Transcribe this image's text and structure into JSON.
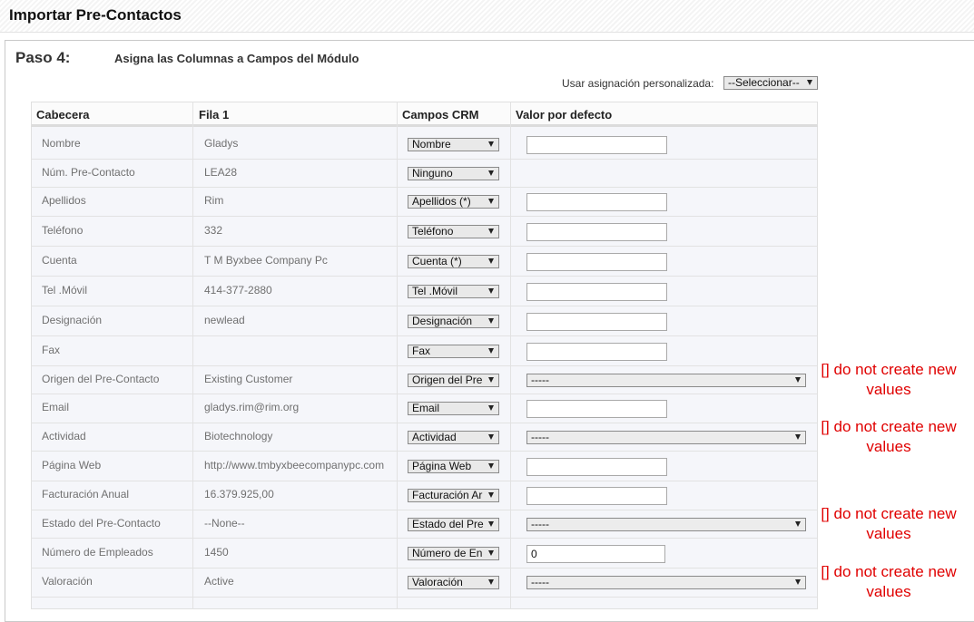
{
  "page": {
    "title": "Importar Pre-Contactos"
  },
  "step": {
    "label": "Paso 4:",
    "description": "Asigna las Columnas a Campos del Módulo"
  },
  "custom_mapping": {
    "label": "Usar asignación personalizada:",
    "value": "--Seleccionar--"
  },
  "table": {
    "headers": [
      "Cabecera",
      "Fila 1",
      "Campos CRM",
      "Valor por defecto"
    ],
    "rows": [
      {
        "header": "Nombre",
        "row1": "Gladys",
        "crm": "Nombre",
        "default": ""
      },
      {
        "header": "Núm. Pre-Contacto",
        "row1": "LEA28",
        "crm": "Ninguno"
      },
      {
        "header": "Apellidos",
        "row1": "Rim",
        "crm": "Apellidos  (*)",
        "default": ""
      },
      {
        "header": "Teléfono",
        "row1": "332",
        "crm": "Teléfono",
        "default": ""
      },
      {
        "header": "Cuenta",
        "row1": "T M Byxbee Company Pc",
        "crm": "Cuenta  (*)",
        "default": ""
      },
      {
        "header": "Tel .Móvil",
        "row1": "414-377-2880",
        "crm": "Tel .Móvil",
        "default": ""
      },
      {
        "header": "Designación",
        "row1": "newlead",
        "crm": "Designación",
        "default": ""
      },
      {
        "header": "Fax",
        "row1": "",
        "crm": "Fax",
        "default": ""
      },
      {
        "header": "Origen del Pre-Contacto",
        "row1": "Existing Customer",
        "crm": "Origen del Pre",
        "default_select": "-----",
        "note": "[] do not create new values"
      },
      {
        "header": "Email",
        "row1": "gladys.rim@rim.org",
        "crm": "Email",
        "default": ""
      },
      {
        "header": "Actividad",
        "row1": "Biotechnology",
        "crm": "Actividad",
        "default_select": "-----",
        "note": "[] do not create new values"
      },
      {
        "header": "Página Web",
        "row1": "http://www.tmbyxbeecompanypc.com",
        "crm": "Página Web",
        "default": ""
      },
      {
        "header": "Facturación Anual",
        "row1": "16.379.925,00",
        "crm": "Facturación Ar",
        "default": ""
      },
      {
        "header": "Estado del Pre-Contacto",
        "row1": "--None--",
        "crm": "Estado del Pre",
        "default_select": "-----",
        "note": "[] do not create new values"
      },
      {
        "header": "Número de Empleados",
        "row1": "1450",
        "crm": "Número de En",
        "default": "0"
      },
      {
        "header": "Valoración",
        "row1": "Active",
        "crm": "Valoración",
        "default_select": "-----",
        "note": "[] do not create new values"
      }
    ]
  }
}
